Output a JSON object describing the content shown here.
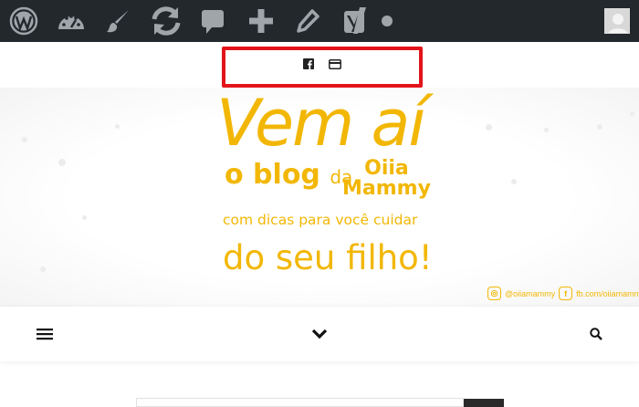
{
  "adminbar": {
    "background": "#23282d",
    "icon_color": "#a0a5aa",
    "items": [
      {
        "name": "wordpress-logo-icon"
      },
      {
        "name": "dashboard-icon"
      },
      {
        "name": "customize-brush-icon"
      },
      {
        "name": "updates-icon"
      },
      {
        "name": "comments-icon"
      },
      {
        "name": "new-content-plus-icon"
      },
      {
        "name": "edit-pencil-icon"
      },
      {
        "name": "yoast-seo-icon"
      },
      {
        "name": "status-dot-icon"
      }
    ]
  },
  "social": {
    "highlight_color": "#e2141a",
    "icons": [
      {
        "name": "facebook-icon"
      },
      {
        "name": "credit-card-icon"
      }
    ]
  },
  "banner": {
    "accent": "#f2b705",
    "headline": "Vem aí",
    "line1_a": "o blog",
    "line1_b": "da",
    "brand_top": "Oiia",
    "brand_bottom": "Mammy",
    "line2": "com dicas para você cuidar",
    "line3": "do seu filho!",
    "instagram": "@oiiamammy",
    "facebook": "fb.com/oiiamammy"
  },
  "navbar": {
    "menu_icon": "hamburger-menu-icon",
    "center_icon": "chevron-down-icon",
    "search_icon": "search-icon"
  },
  "search": {
    "value": "",
    "placeholder": ""
  }
}
